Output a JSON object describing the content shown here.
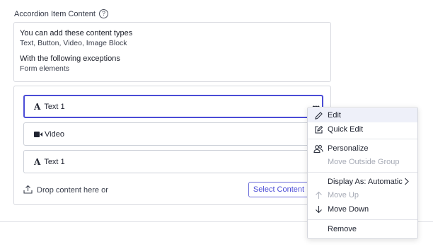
{
  "section": {
    "label": "Accordion Item Content",
    "help_icon": "question-circle-icon",
    "help_glyph": "?"
  },
  "info": {
    "allowed_title": "You can add these content types",
    "allowed_types": "Text, Button, Video, Image Block",
    "exceptions_title": "With the following exceptions",
    "exceptions": "Form elements"
  },
  "items": [
    {
      "label": "Text 1",
      "icon": "text-type-icon",
      "glyph": "A",
      "selected": true
    },
    {
      "label": "Video",
      "icon": "video-camera-icon",
      "selected": false
    },
    {
      "label": "Text 1",
      "icon": "text-type-icon",
      "glyph": "A",
      "selected": false
    }
  ],
  "more_glyph": "•••",
  "drop": {
    "text": "Drop content here or",
    "icon": "upload-icon",
    "button_label": "Select Content"
  },
  "context_menu": {
    "items": [
      {
        "label": "Edit",
        "icon": "pencil-icon",
        "state": "hover"
      },
      {
        "label": "Quick Edit",
        "icon": "edit-square-icon",
        "state": "enabled"
      },
      {
        "label": "Personalize",
        "icon": "users-icon",
        "state": "enabled"
      },
      {
        "label": "Move Outside Group",
        "icon": "",
        "state": "disabled"
      },
      {
        "label": "Display As: Automatic",
        "icon": "",
        "state": "enabled",
        "submenu": true
      },
      {
        "label": "Move Up",
        "icon": "arrow-up-icon",
        "state": "disabled"
      },
      {
        "label": "Move Down",
        "icon": "arrow-down-icon",
        "state": "enabled"
      },
      {
        "label": "Remove",
        "icon": "",
        "state": "enabled"
      }
    ]
  },
  "colors": {
    "accent": "#4b4cd6",
    "border": "#d7d9df",
    "hover_bg": "#eef0f9",
    "disabled_text": "#a7abb6"
  }
}
